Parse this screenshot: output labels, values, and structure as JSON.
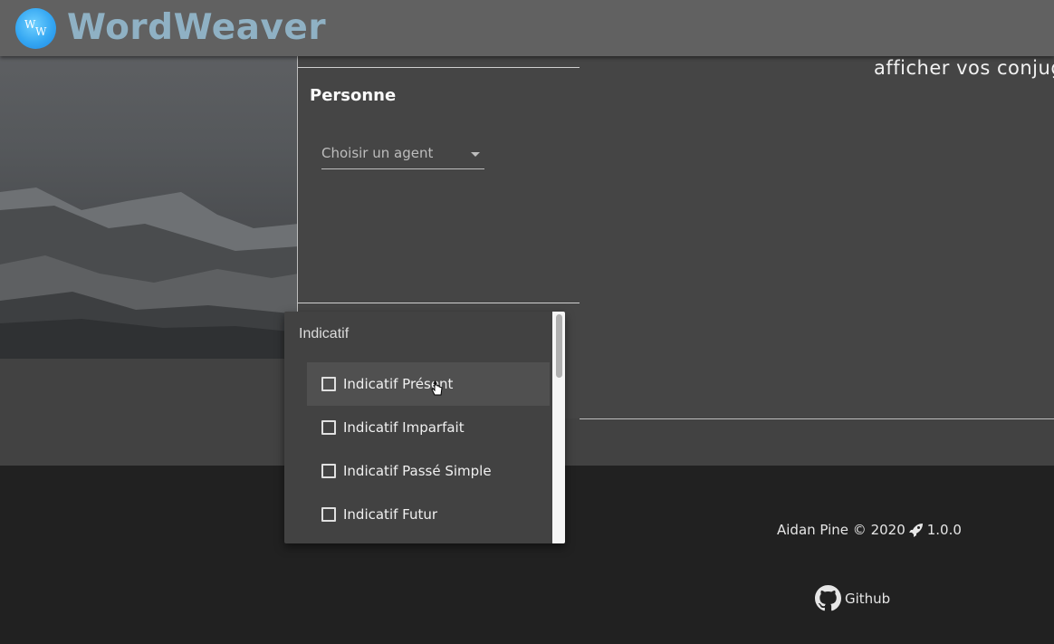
{
  "app": {
    "brand": "WordWeaver",
    "logo_letters": [
      "W",
      "W"
    ]
  },
  "person_panel": {
    "title": "Personne",
    "agent_select": {
      "placeholder": "Choisir un agent"
    }
  },
  "results": {
    "partial_text": "afficher vos conjug"
  },
  "tense_menu": {
    "group_label": "Indicatif",
    "items": [
      {
        "label": "Indicatif Présent",
        "checked": false,
        "hovered": true
      },
      {
        "label": "Indicatif Imparfait",
        "checked": false
      },
      {
        "label": "Indicatif Passé Simple",
        "checked": false
      },
      {
        "label": "Indicatif Futur",
        "checked": false
      }
    ]
  },
  "footer": {
    "copyright": "Aidan Pine © 2020",
    "version": "1.0.0",
    "github_label": "Github"
  },
  "colors": {
    "appbar": "#616161",
    "brand_text": "#8fb1c4",
    "logo": "#35a7f2",
    "panel": "#454545",
    "footer": "#212121"
  }
}
